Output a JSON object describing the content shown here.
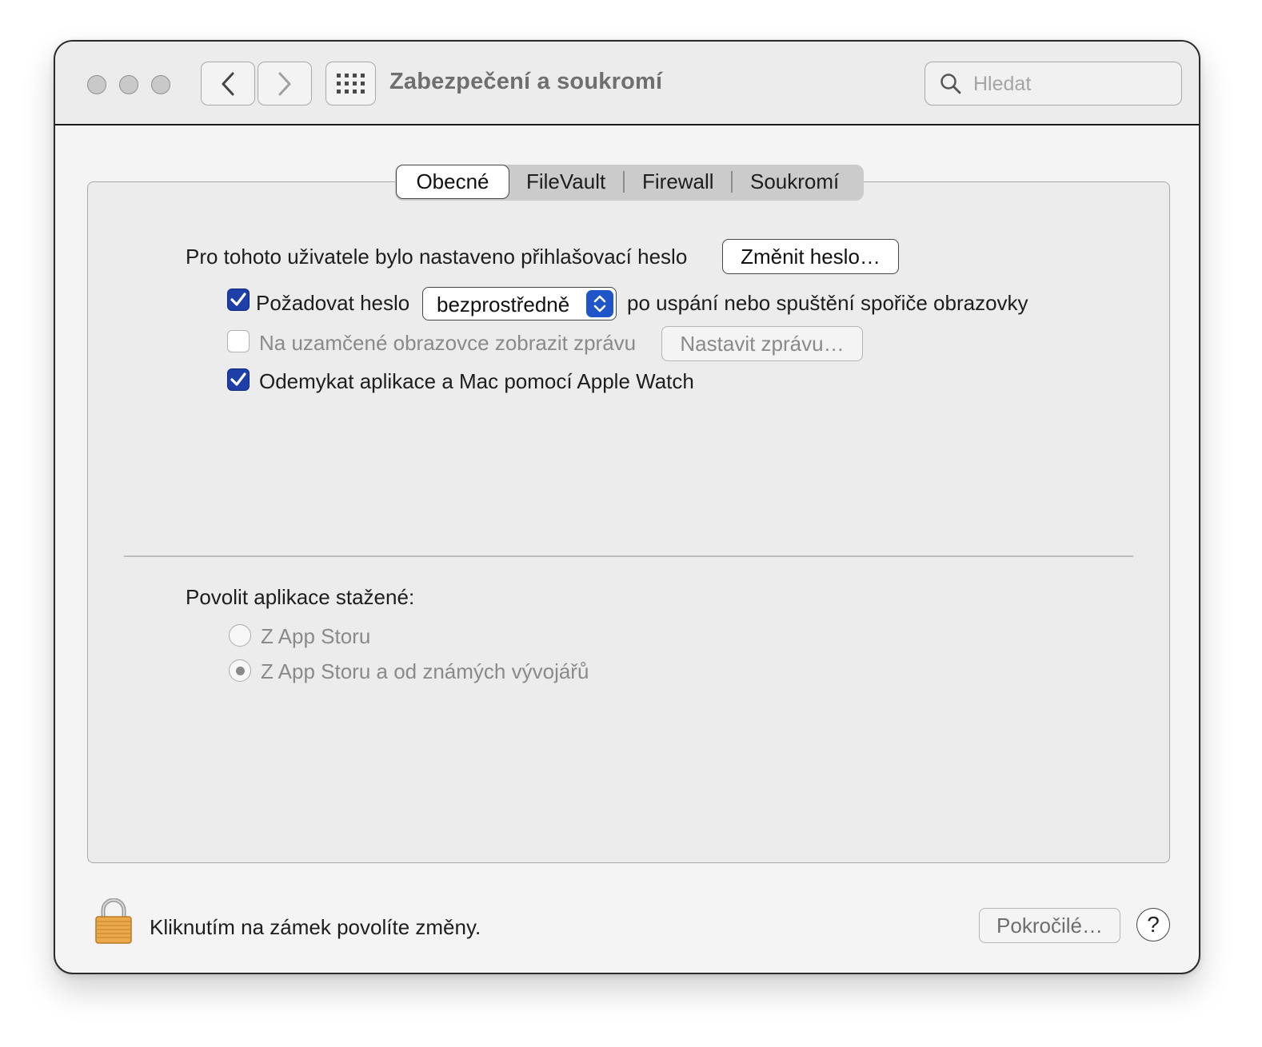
{
  "window": {
    "title": "Zabezpečení a soukromí",
    "search_placeholder": "Hledat"
  },
  "tabs": {
    "items": [
      "Obecné",
      "FileVault",
      "Firewall",
      "Soukromí"
    ],
    "selected": "Obecné"
  },
  "general": {
    "password_set_text": "Pro tohoto uživatele bylo nastaveno přihlašovací heslo",
    "change_password_button": "Změnit heslo…",
    "require_password": {
      "label": "Požadovat heslo",
      "checked": true,
      "selected_option": "bezprostředně",
      "suffix": "po uspání nebo spuštění spořiče obrazovky"
    },
    "lock_message": {
      "label": "Na uzamčené obrazovce zobrazit zprávu",
      "checked": false,
      "enabled": false,
      "button": "Nastavit zprávu…"
    },
    "apple_watch": {
      "label": "Odemykat aplikace a Mac pomocí Apple Watch",
      "checked": true
    }
  },
  "downloads": {
    "heading": "Povolit aplikace stažené:",
    "options": [
      {
        "label": "Z App Storu",
        "selected": false
      },
      {
        "label": "Z App Storu a od známých vývojářů",
        "selected": true
      }
    ]
  },
  "footer": {
    "lock_text": "Kliknutím na zámek povolíte změny.",
    "advanced_button": "Pokročilé…",
    "help_label": "?"
  },
  "colors": {
    "accent": "#1e3fa8",
    "popup_arrows": "#1f55c9",
    "disabled_text": "#8a8a8a"
  }
}
